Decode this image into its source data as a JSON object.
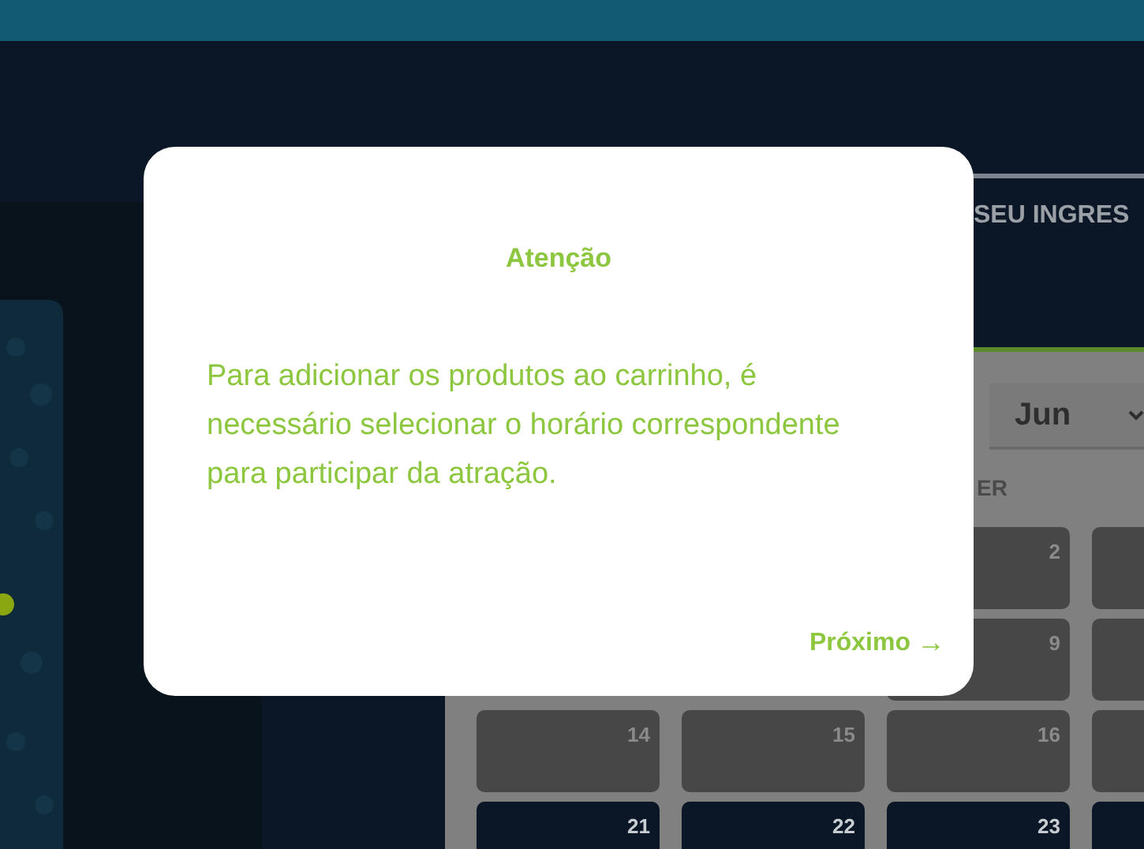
{
  "header_tab": "SEU INGRES",
  "month_select": {
    "value": "Jun"
  },
  "weekday_label": "ER",
  "calendar_rows": [
    {
      "days": [
        {
          "day": "2",
          "available": false
        },
        {
          "available": false
        }
      ]
    },
    {
      "days": [
        {
          "day": "9",
          "available": false
        },
        {
          "available": false
        }
      ]
    },
    {
      "days": [
        {
          "day": "14",
          "available": false
        },
        {
          "day": "15",
          "available": false
        },
        {
          "day": "16",
          "available": false
        },
        {
          "available": false
        }
      ]
    },
    {
      "days": [
        {
          "day": "21",
          "available": true
        },
        {
          "day": "22",
          "available": true
        },
        {
          "day": "23",
          "available": true
        },
        {
          "available": true
        }
      ]
    }
  ],
  "modal": {
    "title": "Atenção",
    "message": "Para adicionar os produtos ao carrinho, é necessário selecionar o horário correspondente para participar da atração.",
    "next_button": {
      "label": "Próximo",
      "arrow": "→"
    }
  }
}
